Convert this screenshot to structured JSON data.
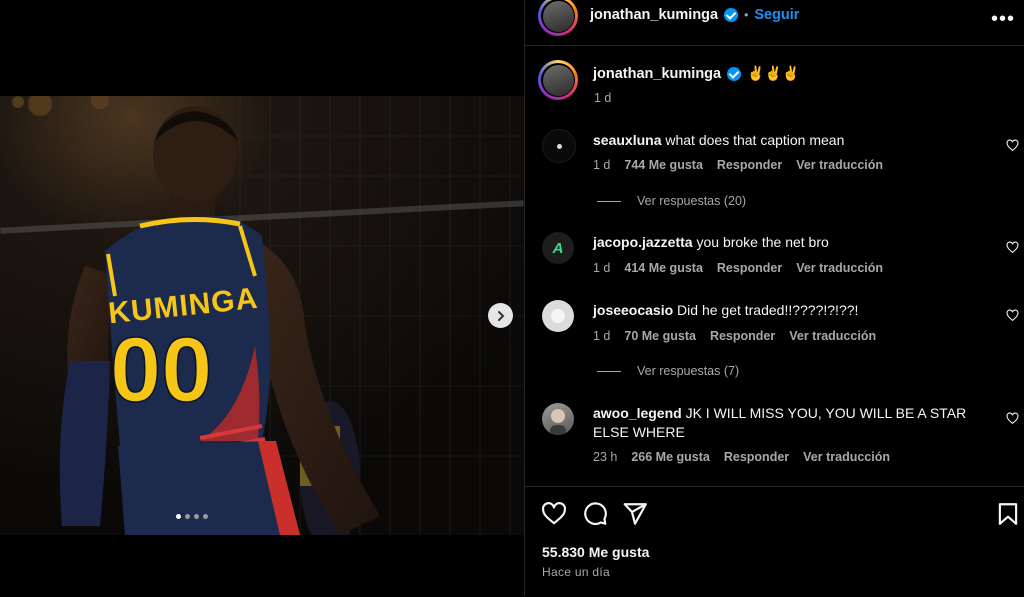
{
  "post": {
    "author": "jonathan_kuminga",
    "follow_label": "Seguir",
    "more_label": "•••",
    "caption": "✌️✌️✌️",
    "caption_time": "1 d",
    "jersey_name": "KUMINGA",
    "jersey_number": "00",
    "carousel_dots": 4,
    "carousel_active": 1
  },
  "comments": [
    {
      "user": "seauxluna",
      "text": "what does that caption mean",
      "time": "1 d",
      "likes": "744 Me gusta",
      "reply": "Responder",
      "translate": "Ver traducción",
      "replies": "Ver respuestas (20)"
    },
    {
      "user": "jacopo.jazzetta",
      "text": "you broke the net bro",
      "time": "1 d",
      "likes": "414 Me gusta",
      "reply": "Responder",
      "translate": "Ver traducción"
    },
    {
      "user": "joseeocasio",
      "text": "Did he get traded!!????!?!??!",
      "time": "1 d",
      "likes": "70 Me gusta",
      "reply": "Responder",
      "translate": "Ver traducción",
      "replies": "Ver respuestas (7)"
    },
    {
      "user": "awoo_legend",
      "text": "JK I WILL MISS YOU, YOU WILL BE A STAR ELSE WHERE",
      "time": "23 h",
      "likes": "266 Me gusta",
      "reply": "Responder",
      "translate": "Ver traducción"
    }
  ],
  "footer": {
    "likes": "55.830 Me gusta",
    "posted": "Hace un día"
  },
  "icons": {
    "like": "heart-icon",
    "comment": "comment-icon",
    "share": "send-icon",
    "save": "bookmark-icon",
    "next": "chevron-right-icon"
  },
  "colors": {
    "accent": "#1f8ff2",
    "verified": "#0095f6",
    "jersey_navy": "#1c2a4e",
    "jersey_yellow": "#f5c518"
  }
}
